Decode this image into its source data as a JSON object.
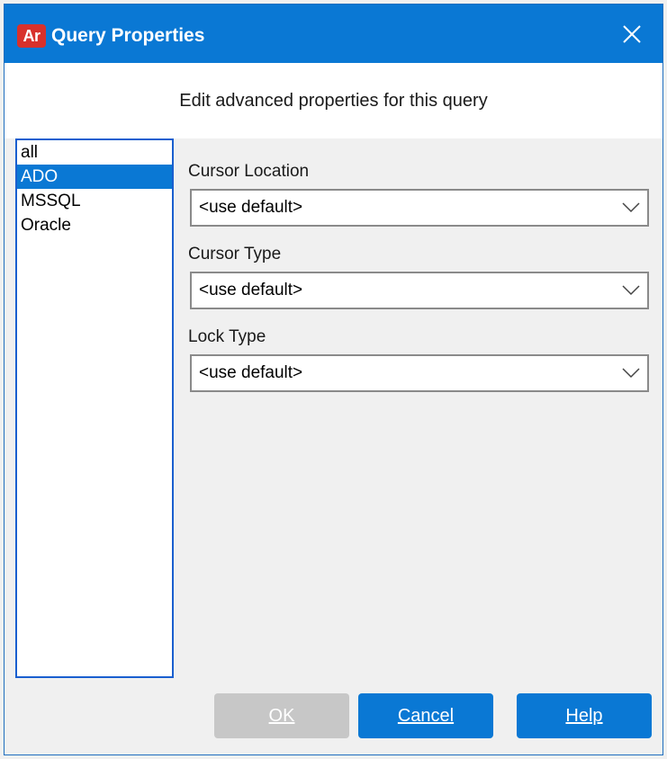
{
  "window": {
    "title": "Query Properties",
    "app_icon_text": "Ar",
    "close_icon": "close-icon"
  },
  "subheader": {
    "text": "Edit advanced properties for this query"
  },
  "list": {
    "items": [
      "all",
      "ADO",
      "MSSQL",
      "Oracle"
    ],
    "selected": "ADO"
  },
  "fields": {
    "cursor_location": {
      "label": "Cursor Location",
      "value": "<use default>"
    },
    "cursor_type": {
      "label": "Cursor Type",
      "value": "<use default>"
    },
    "lock_type": {
      "label": "Lock Type",
      "value": "<use default>"
    }
  },
  "buttons": {
    "ok": {
      "label": "OK",
      "enabled": false
    },
    "cancel": {
      "label": "Cancel",
      "enabled": true
    },
    "help": {
      "label": "Help",
      "enabled": true
    }
  },
  "colors": {
    "titlebar": "#0a78d4",
    "selection": "#0a78d4",
    "app_icon": "#d8312b"
  }
}
